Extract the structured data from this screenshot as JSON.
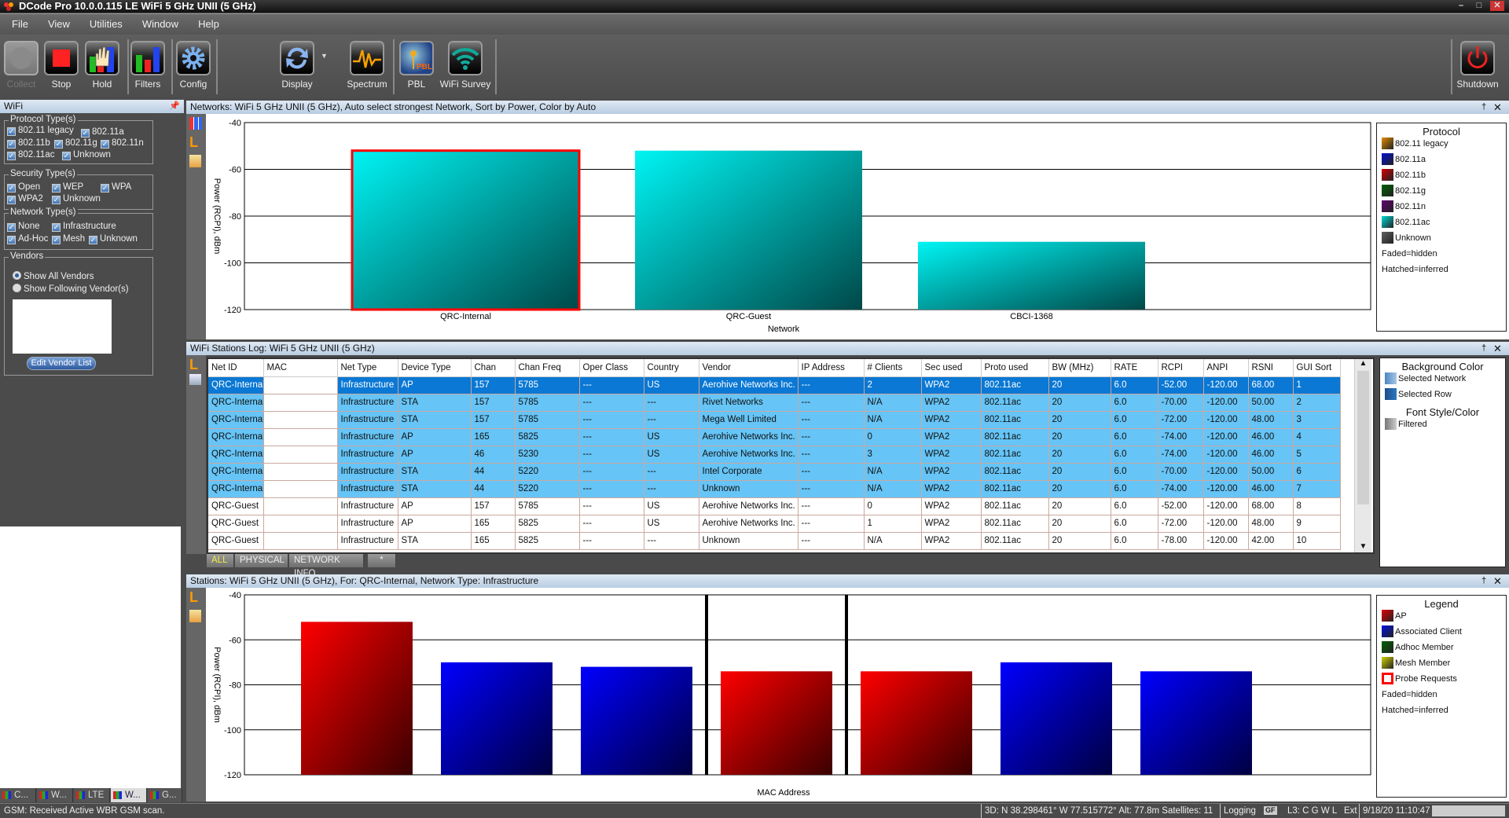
{
  "window": {
    "title": "DCode Pro 10.0.0.115 LE  WiFi 5 GHz UNII (5 GHz)"
  },
  "menu": [
    "File",
    "View",
    "Utilities",
    "Window",
    "Help"
  ],
  "toolbar": {
    "collect": "Collect",
    "stop": "Stop",
    "hold": "Hold",
    "filters": "Filters",
    "config": "Config",
    "display": "Display",
    "spectrum": "Spectrum",
    "pbl": "PBL",
    "wifi_survey": "WiFi Survey",
    "shutdown": "Shutdown"
  },
  "left": {
    "title": "WiFi",
    "protocol": {
      "title": "Protocol Type(s)",
      "items": [
        "802.11 legacy",
        "802.11a",
        "802.11b",
        "802.11g",
        "802.11n",
        "802.11ac",
        "Unknown"
      ]
    },
    "security": {
      "title": "Security Type(s)",
      "items": [
        "Open",
        "WEP",
        "WPA",
        "WPA2",
        "Unknown"
      ]
    },
    "network": {
      "title": "Network Type(s)",
      "items": [
        "None",
        "Infrastructure",
        "Ad-Hoc",
        "Mesh",
        "Unknown"
      ]
    },
    "vendors": {
      "title": "Vendors",
      "show_all": "Show All Vendors",
      "show_following": "Show Following Vendor(s)",
      "selected": "Show All Vendors",
      "edit": "Edit Vendor List"
    },
    "bottom_tabs": [
      "C...",
      "W...",
      "LTE",
      "W...",
      "G..."
    ]
  },
  "networks_panel": {
    "title": "Networks: WiFi 5 GHz UNII (5 GHz), Auto select strongest Network, Sort by Power, Color by Auto"
  },
  "stations_log": {
    "title": "WiFi Stations Log: WiFi 5 GHz UNII (5 GHz)",
    "columns": [
      "Net ID",
      "MAC",
      "Net Type",
      "Device Type",
      "Chan",
      "Chan Freq",
      "Oper Class",
      "Country",
      "Vendor",
      "IP Address",
      "# Clients",
      "Sec used",
      "Proto used",
      "BW (MHz)",
      "RATE",
      "RCPI",
      "ANPI",
      "RSNI",
      "GUI Sort"
    ],
    "rows": [
      [
        "QRC-Internal",
        "",
        "Infrastructure",
        "AP",
        "157",
        "5785",
        "---",
        "US",
        "Aerohive Networks Inc.",
        "---",
        "2",
        "WPA2",
        "802.11ac",
        "20",
        "6.0",
        "-52.00",
        "-120.00",
        "68.00",
        "1"
      ],
      [
        "QRC-Internal",
        "",
        "Infrastructure",
        "STA",
        "157",
        "5785",
        "---",
        "---",
        "Rivet Networks",
        "---",
        "N/A",
        "WPA2",
        "802.11ac",
        "20",
        "6.0",
        "-70.00",
        "-120.00",
        "50.00",
        "2"
      ],
      [
        "QRC-Internal",
        "",
        "Infrastructure",
        "STA",
        "157",
        "5785",
        "---",
        "---",
        "Mega Well Limited",
        "---",
        "N/A",
        "WPA2",
        "802.11ac",
        "20",
        "6.0",
        "-72.00",
        "-120.00",
        "48.00",
        "3"
      ],
      [
        "QRC-Internal",
        "",
        "Infrastructure",
        "AP",
        "165",
        "5825",
        "---",
        "US",
        "Aerohive Networks Inc.",
        "---",
        "0",
        "WPA2",
        "802.11ac",
        "20",
        "6.0",
        "-74.00",
        "-120.00",
        "46.00",
        "4"
      ],
      [
        "QRC-Internal",
        "",
        "Infrastructure",
        "AP",
        "46",
        "5230",
        "---",
        "US",
        "Aerohive Networks Inc.",
        "---",
        "3",
        "WPA2",
        "802.11ac",
        "20",
        "6.0",
        "-74.00",
        "-120.00",
        "46.00",
        "5"
      ],
      [
        "QRC-Internal",
        "",
        "Infrastructure",
        "STA",
        "44",
        "5220",
        "---",
        "---",
        "Intel Corporate",
        "---",
        "N/A",
        "WPA2",
        "802.11ac",
        "20",
        "6.0",
        "-70.00",
        "-120.00",
        "50.00",
        "6"
      ],
      [
        "QRC-Internal",
        "",
        "Infrastructure",
        "STA",
        "44",
        "5220",
        "---",
        "---",
        "Unknown",
        "---",
        "N/A",
        "WPA2",
        "802.11ac",
        "20",
        "6.0",
        "-74.00",
        "-120.00",
        "46.00",
        "7"
      ],
      [
        "QRC-Guest",
        "",
        "Infrastructure",
        "AP",
        "157",
        "5785",
        "---",
        "US",
        "Aerohive Networks Inc.",
        "---",
        "0",
        "WPA2",
        "802.11ac",
        "20",
        "6.0",
        "-52.00",
        "-120.00",
        "68.00",
        "8"
      ],
      [
        "QRC-Guest",
        "",
        "Infrastructure",
        "AP",
        "165",
        "5825",
        "---",
        "US",
        "Aerohive Networks Inc.",
        "---",
        "1",
        "WPA2",
        "802.11ac",
        "20",
        "6.0",
        "-72.00",
        "-120.00",
        "48.00",
        "9"
      ],
      [
        "QRC-Guest",
        "",
        "Infrastructure",
        "STA",
        "165",
        "5825",
        "---",
        "---",
        "Unknown",
        "---",
        "N/A",
        "WPA2",
        "802.11ac",
        "20",
        "6.0",
        "-78.00",
        "-120.00",
        "42.00",
        "10"
      ]
    ],
    "tabs": [
      "ALL",
      "PHYSICAL",
      "NETWORK INFO",
      "*"
    ],
    "active_tab": "ALL",
    "legend": {
      "bg_title": "Background Color",
      "selected_network": "Selected Network",
      "selected_row": "Selected Row",
      "font_title": "Font Style/Color",
      "filtered": "Filtered"
    }
  },
  "stations_panel": {
    "title": "Stations: WiFi 5 GHz UNII (5 GHz), For: QRC-Internal, Network Type: Infrastructure"
  },
  "chart_data": [
    {
      "type": "bar",
      "title": "",
      "xlabel": "Network",
      "ylabel": "Power (RCPI), dBm",
      "ylim": [
        -120,
        -40
      ],
      "yticks": [
        -40,
        -60,
        -80,
        -100,
        -120
      ],
      "grid": true,
      "categories": [
        "QRC-Internal",
        "QRC-Guest",
        "CBCI-1368"
      ],
      "values": [
        -52,
        -52,
        -91
      ],
      "highlighted": "QRC-Internal",
      "legend": {
        "title": "Protocol",
        "placement": "right",
        "items": [
          {
            "label": "802.11 legacy",
            "color": "#e08c00"
          },
          {
            "label": "802.11a",
            "color": "#0010d0"
          },
          {
            "label": "802.11b",
            "color": "#d00000"
          },
          {
            "label": "802.11g",
            "color": "#006000"
          },
          {
            "label": "802.11n",
            "color": "#600070"
          },
          {
            "label": "802.11ac",
            "color": "#00d8d8"
          },
          {
            "label": "Unknown",
            "color": "#606060"
          }
        ],
        "notes": [
          "Faded=hidden",
          "Hatched=inferred"
        ]
      }
    },
    {
      "type": "bar",
      "title": "",
      "xlabel": "MAC Address",
      "ylabel": "Power (RCPI), dBm",
      "ylim": [
        -120,
        -40
      ],
      "yticks": [
        -40,
        -60,
        -80,
        -100,
        -120
      ],
      "grid": true,
      "values": [
        -52,
        -70,
        -72,
        -74,
        -74,
        -70,
        -74
      ],
      "kinds": [
        "AP",
        "Associated Client",
        "Associated Client",
        "AP",
        "AP",
        "Associated Client",
        "Associated Client"
      ],
      "group_separators_after": [
        3,
        4
      ],
      "legend": {
        "title": "Legend",
        "placement": "right",
        "items": [
          {
            "label": "AP",
            "color": "#e00000"
          },
          {
            "label": "Associated Client",
            "color": "#0010e0"
          },
          {
            "label": "Adhoc Member",
            "color": "#006000"
          },
          {
            "label": "Mesh Member",
            "color": "#d0d000"
          },
          {
            "label": "Probe Requests",
            "color": "#ff0000",
            "outline": true
          }
        ],
        "notes": [
          "Faded=hidden",
          "Hatched=inferred"
        ]
      }
    }
  ],
  "status": {
    "message": "GSM: Received Active WBR GSM scan.",
    "gps": "3D: N 38.298461°  W 77.515772°  Alt: 77.8m  Satellites: 11",
    "logging": "Logging",
    "gf": "GF",
    "l3": "L3: C G W L",
    "ext": "Ext",
    "datetime": "9/18/20 11:10:47"
  }
}
